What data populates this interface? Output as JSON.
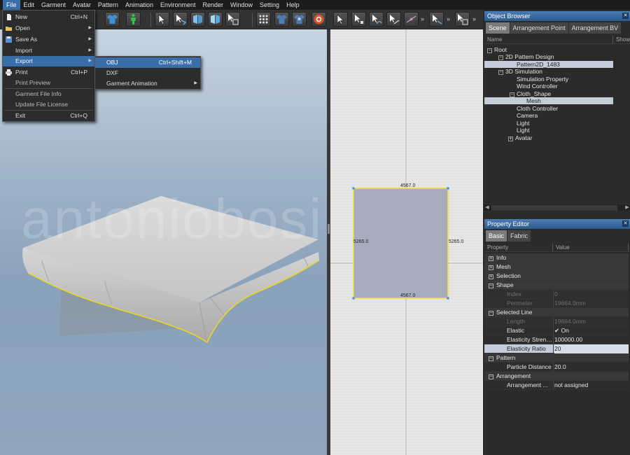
{
  "menubar": [
    "File",
    "Edit",
    "Garment",
    "Avatar",
    "Pattern",
    "Animation",
    "Environment",
    "Render",
    "Window",
    "Setting",
    "Help"
  ],
  "file_menu": {
    "new": {
      "label": "New",
      "shortcut": "Ctrl+N"
    },
    "open": {
      "label": "Open"
    },
    "save_as": {
      "label": "Save As"
    },
    "import": {
      "label": "Import"
    },
    "export": {
      "label": "Export"
    },
    "print": {
      "label": "Print",
      "shortcut": "Ctrl+P"
    },
    "print_preview": {
      "label": "Print Preview"
    },
    "garment_file_info": {
      "label": "Garment File Info"
    },
    "update_license": {
      "label": "Update File License"
    },
    "exit": {
      "label": "Exit",
      "shortcut": "Ctrl+Q"
    }
  },
  "export_menu": {
    "obj": {
      "label": "OBJ",
      "shortcut": "Ctrl+Shift+M"
    },
    "dxf": {
      "label": "DXF"
    },
    "garment_animation": {
      "label": "Garment Animation"
    }
  },
  "toolbar": {
    "more": "»"
  },
  "watermark": "antoniobosi.com",
  "pattern2d": {
    "top_label": "4567.0",
    "bottom_label": "4567.0",
    "left_label": "5265.0",
    "right_label": "5265.0",
    "fill_color": "#a8acbf",
    "outline_color": "#f2e12a"
  },
  "object_browser": {
    "title": "Object Browser",
    "tabs": [
      "Scene",
      "Arrangement Point",
      "Arrangement BV"
    ],
    "col_name": "Name",
    "col_show": "Show",
    "tree": {
      "root": "Root",
      "pattern_design": "2D Pattern Design",
      "pattern": "Pattern2D_1483",
      "simulation": "3D Simulation",
      "sim_property": "Simulation Property",
      "wind_controller": "Wind Controller",
      "cloth_shape": "Cloth_Shape",
      "mesh": "Mesh",
      "cloth_controller": "Cloth Controller",
      "camera": "Camera",
      "light1": "Light",
      "light2": "Light",
      "avatar": "Avatar"
    }
  },
  "property_editor": {
    "title": "Property Editor",
    "tabs": [
      "Basic",
      "Fabric"
    ],
    "col_property": "Property",
    "col_value": "Value",
    "groups": {
      "info": "Info",
      "mesh": "Mesh",
      "selection": "Selection",
      "shape": "Shape",
      "selected_line": "Selected Line",
      "pattern": "Pattern",
      "arrangement": "Arrangement"
    },
    "rows": {
      "index": {
        "name": "Index",
        "value": "0"
      },
      "perimeter": {
        "name": "Perimeter",
        "value": "19664.0mm"
      },
      "length": {
        "name": "Length",
        "value": "19664.0mm"
      },
      "elastic": {
        "name": "Elastic",
        "value": "On"
      },
      "elasticity_strength": {
        "name": "Elasticity Strength",
        "value": "100000.00"
      },
      "elasticity_ratio": {
        "name": "Elasticity Ratio",
        "value": "20"
      },
      "particle_distance": {
        "name": "Particle Distance",
        "value": "20.0"
      },
      "arrangement": {
        "name": "Arrangement ...",
        "value": "not assigned"
      }
    }
  },
  "colors": {
    "accent": "#3a6ea8",
    "selection": "#c3ccd8",
    "cloth_outline": "#e8d820"
  }
}
